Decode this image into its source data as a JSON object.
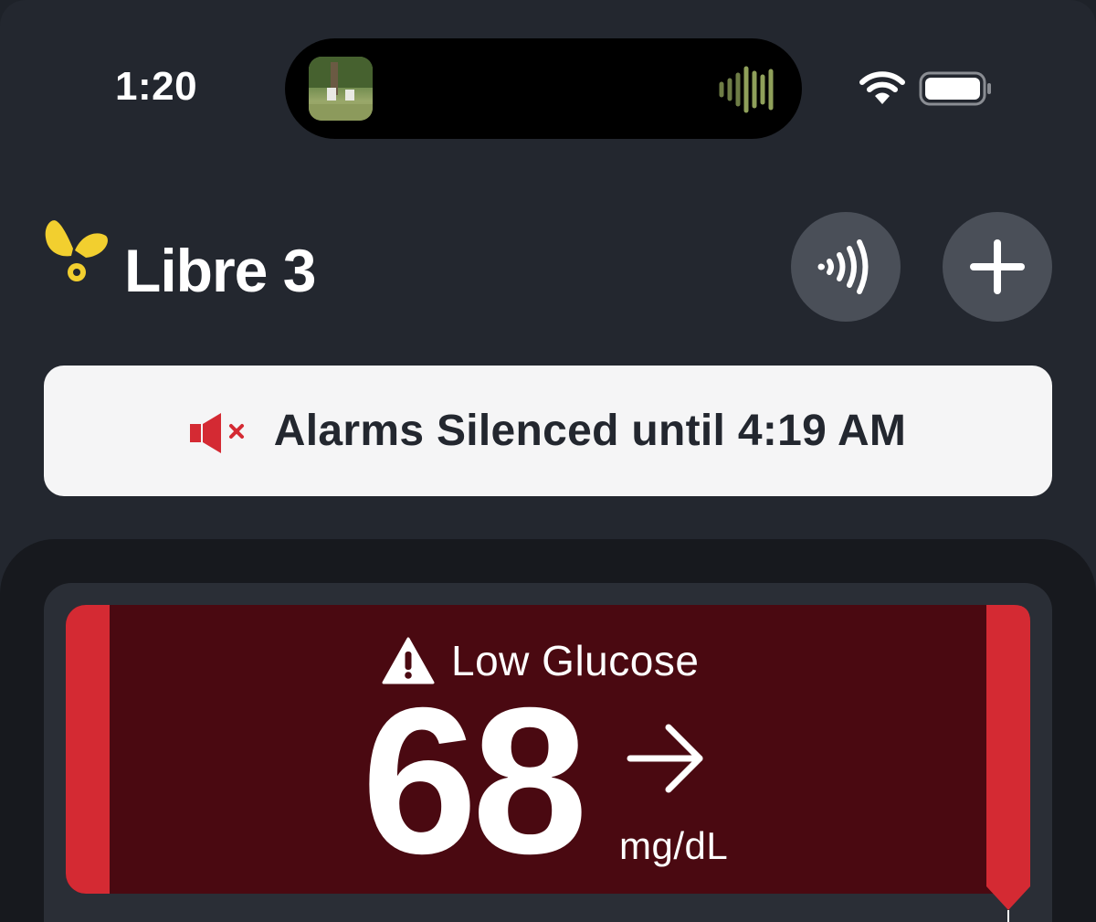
{
  "status_bar": {
    "time": "1:20"
  },
  "header": {
    "app_title": "Libre 3",
    "brand_color": "#f2cf2f"
  },
  "alarm_banner": {
    "text": "Alarms Silenced until 4:19 AM",
    "icon": "speaker-muted-icon",
    "icon_color": "#d42a33"
  },
  "reading": {
    "status": "Low Glucose",
    "value": "68",
    "unit": "mg/dL",
    "trend": "arrow-right-icon",
    "panel_color": "#4a0911",
    "accent_color": "#d42a33"
  },
  "colors": {
    "background": "#23272f",
    "button": "#4a4f58",
    "banner": "#f5f5f6"
  }
}
